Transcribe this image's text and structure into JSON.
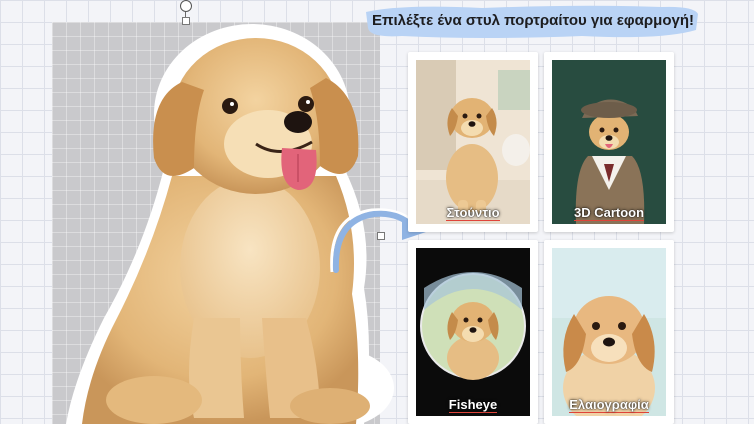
{
  "title": "Επιλέξτε ένα στυλ πορτραίτου για εφαρμογή!",
  "styles": [
    {
      "label": "Στούντιο"
    },
    {
      "label": "3D Cartoon"
    },
    {
      "label": "Fisheye"
    },
    {
      "label": "Ελαιογραφία"
    }
  ],
  "colors": {
    "banner": "#b9d3f5",
    "accent_underline": "#e0453a",
    "arrow": "#8fb3e3"
  }
}
